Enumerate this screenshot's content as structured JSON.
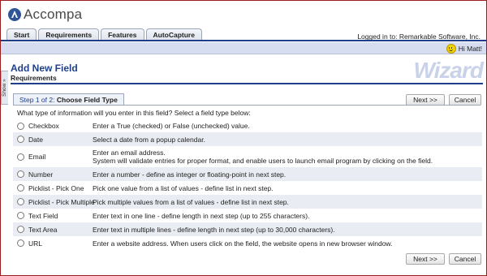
{
  "app": {
    "name": "Accompa"
  },
  "nav": {
    "tabs": [
      "Start",
      "Requirements",
      "Features",
      "AutoCapture"
    ]
  },
  "header": {
    "logged_in": "Logged in to: Remarkable Software, Inc.",
    "greeting": "Hi Matt!",
    "show_handle": "Show »"
  },
  "page": {
    "title": "Add New Field",
    "subtitle": "Requirements",
    "watermark": "Wizard"
  },
  "step": {
    "label_prefix": "Step 1 of 2:",
    "label_title": "Choose Field Type",
    "next_label": "Next >>",
    "cancel_label": "Cancel"
  },
  "question": "What type of information will you enter in this field? Select a field type below:",
  "field_types": [
    {
      "label": "Checkbox",
      "desc": [
        "Enter a True (checked) or False (unchecked) value."
      ]
    },
    {
      "label": "Date",
      "desc": [
        "Select a date from a popup calendar."
      ]
    },
    {
      "label": "Email",
      "desc": [
        "Enter an email address.",
        "System will validate entries for proper format, and enable users to launch email program by clicking on the field."
      ]
    },
    {
      "label": "Number",
      "desc": [
        "Enter a number - define as integer or floating-point in next step."
      ]
    },
    {
      "label": "Picklist - Pick One",
      "desc": [
        "Pick one value from a list of values - define list in next step."
      ]
    },
    {
      "label": "Picklist - Pick Multiple",
      "desc": [
        "Pick multiple values from a list of values - define list in next step."
      ]
    },
    {
      "label": "Text Field",
      "desc": [
        "Enter text in one line - define length in next step (up to 255 characters)."
      ]
    },
    {
      "label": "Text Area",
      "desc": [
        "Enter text in multiple lines - define length in next step (up to 30,000 characters)."
      ]
    },
    {
      "label": "URL",
      "desc": [
        "Enter a website address. When users click on the field, the website opens in new browser window."
      ]
    }
  ],
  "colors": {
    "brand_blue": "#1f3f8a",
    "row_alt": "#e9ecf3",
    "border_red": "#9b1c1c"
  }
}
